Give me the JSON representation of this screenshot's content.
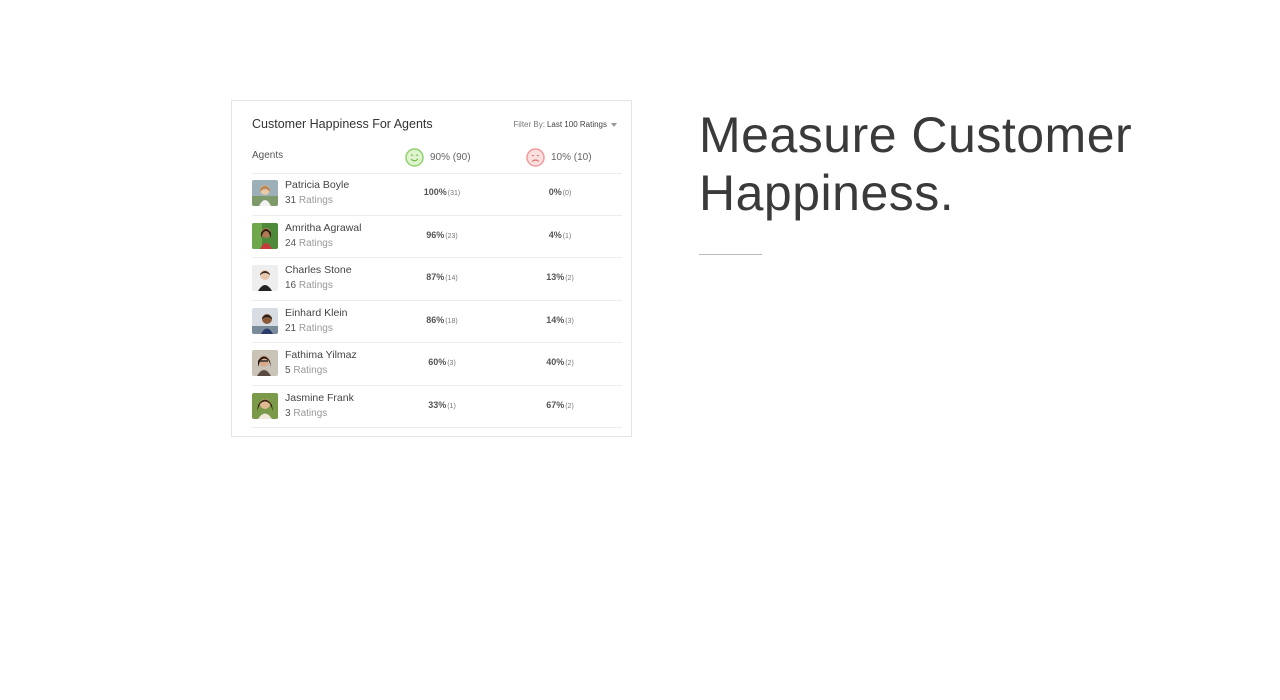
{
  "card": {
    "title": "Customer Happiness For Agents",
    "filter_label": "Filter By:",
    "filter_value": "Last 100 Ratings",
    "agents_header": "Agents",
    "happy_summary": "90% (90)",
    "sad_summary": "10% (10)"
  },
  "agents": [
    {
      "name": "Patricia Boyle",
      "ratings_count": "31",
      "ratings_word": "Ratings",
      "happy_pct": "100%",
      "happy_cnt": "(31)",
      "sad_pct": "0%",
      "sad_cnt": "(0)"
    },
    {
      "name": "Amritha Agrawal",
      "ratings_count": "24",
      "ratings_word": "Ratings",
      "happy_pct": "96%",
      "happy_cnt": "(23)",
      "sad_pct": "4%",
      "sad_cnt": "(1)"
    },
    {
      "name": "Charles Stone",
      "ratings_count": "16",
      "ratings_word": "Ratings",
      "happy_pct": "87%",
      "happy_cnt": "(14)",
      "sad_pct": "13%",
      "sad_cnt": "(2)"
    },
    {
      "name": "Einhard Klein",
      "ratings_count": "21",
      "ratings_word": "Ratings",
      "happy_pct": "86%",
      "happy_cnt": "(18)",
      "sad_pct": "14%",
      "sad_cnt": "(3)"
    },
    {
      "name": "Fathima Yilmaz",
      "ratings_count": "5",
      "ratings_word": "Ratings",
      "happy_pct": "60%",
      "happy_cnt": "(3)",
      "sad_pct": "40%",
      "sad_cnt": "(2)"
    },
    {
      "name": "Jasmine Frank",
      "ratings_count": "3",
      "ratings_word": "Ratings",
      "happy_pct": "33%",
      "happy_cnt": "(1)",
      "sad_pct": "67%",
      "sad_cnt": "(2)"
    }
  ],
  "headline": {
    "line1": "Measure Customer",
    "line2": "Happiness."
  },
  "icons": {
    "happy": "smiley-face-icon",
    "sad": "sad-face-icon"
  },
  "colors": {
    "happy_face": "#8fd36f",
    "sad_face": "#f29a9a",
    "text_dark": "#333333",
    "text_muted": "#999999"
  }
}
